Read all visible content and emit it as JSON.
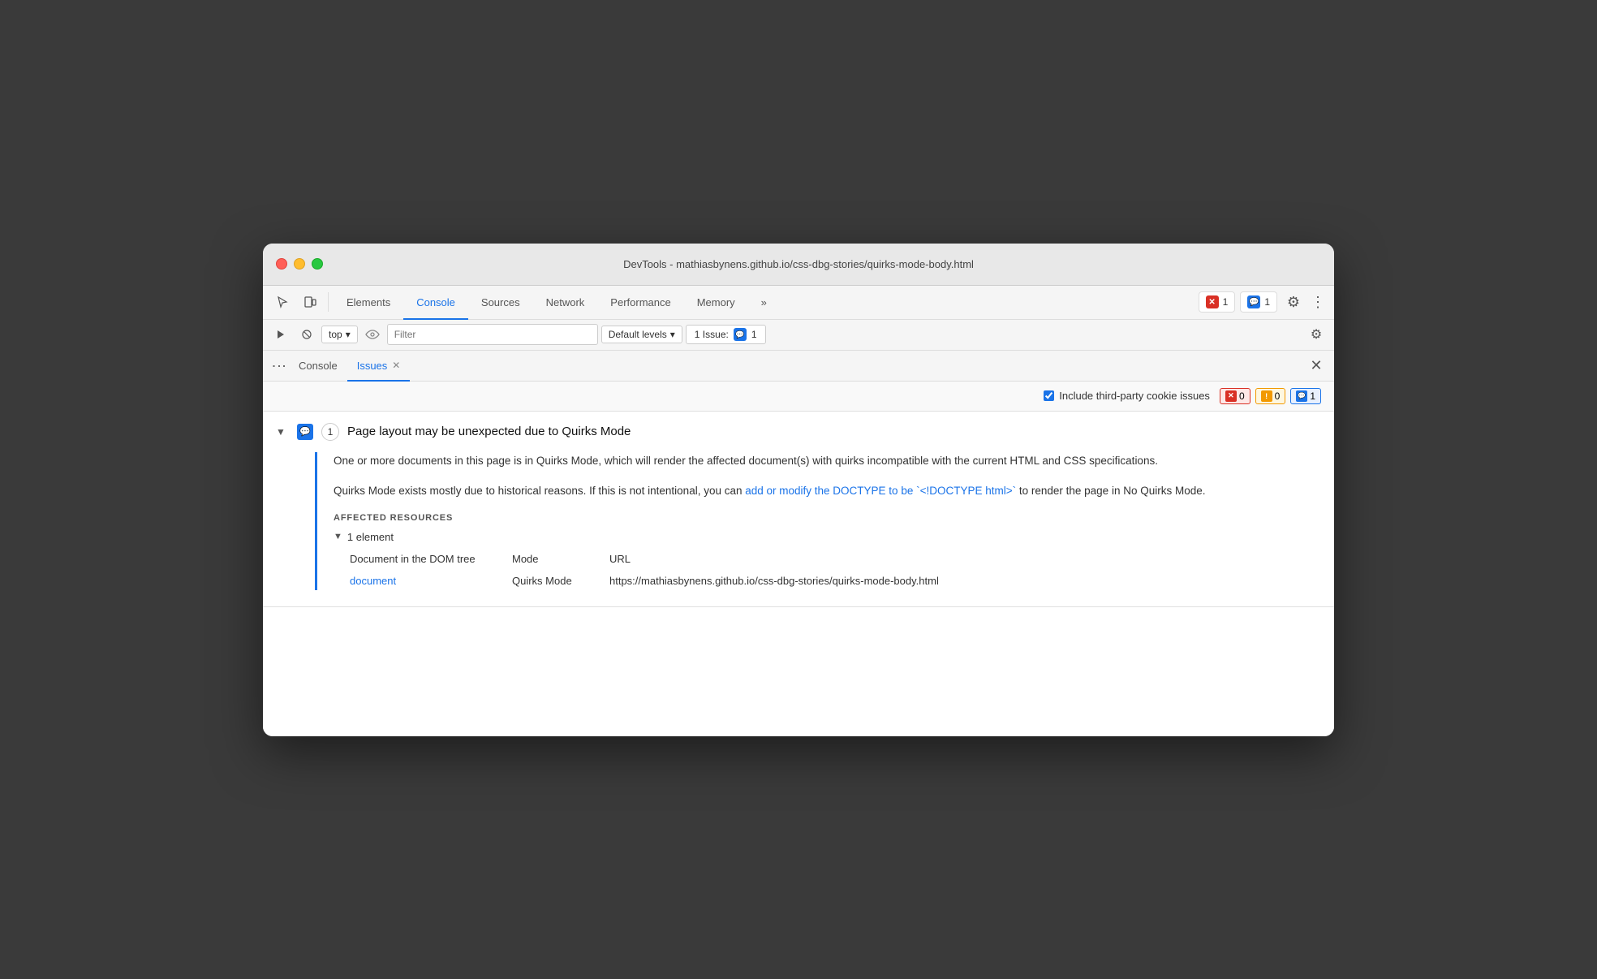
{
  "window": {
    "title": "DevTools - mathiasbynens.github.io/css-dbg-stories/quirks-mode-body.html"
  },
  "tabs": {
    "items": [
      {
        "label": "Elements",
        "active": false
      },
      {
        "label": "Console",
        "active": true
      },
      {
        "label": "Sources",
        "active": false
      },
      {
        "label": "Network",
        "active": false
      },
      {
        "label": "Performance",
        "active": false
      },
      {
        "label": "Memory",
        "active": false
      },
      {
        "label": "»",
        "active": false
      }
    ]
  },
  "toolbar": {
    "error_count": "1",
    "message_count": "1"
  },
  "console_toolbar": {
    "context_selector": "top",
    "filter_placeholder": "Filter",
    "levels_label": "Default levels",
    "issues_label": "1 Issue:",
    "issues_count": "1"
  },
  "panel": {
    "dots": "⋮",
    "tabs": [
      {
        "label": "Console",
        "active": false,
        "closeable": false
      },
      {
        "label": "Issues",
        "active": true,
        "closeable": true
      }
    ]
  },
  "issues_filter": {
    "include_third_party_label": "Include third-party cookie issues",
    "error_count": "0",
    "warning_count": "0",
    "info_count": "1"
  },
  "issue": {
    "title": "Page layout may be unexpected due to Quirks Mode",
    "count": "1",
    "description_1": "One or more documents in this page is in Quirks Mode, which will render the affected document(s) with quirks incompatible with the current HTML and CSS specifications.",
    "description_2_prefix": "Quirks Mode exists mostly due to historical reasons. If this is not intentional, you can ",
    "description_2_link": "add or modify the DOCTYPE to be `<!DOCTYPE html>`",
    "description_2_suffix": " to render the page in No Quirks Mode.",
    "affected_label": "Affected Resources",
    "element_count": "1 element",
    "col_doc": "Document in the DOM tree",
    "col_mode": "Mode",
    "col_url": "URL",
    "doc_link": "document",
    "mode_value": "Quirks Mode",
    "url_value": "https://mathiasbynens.github.io/css-dbg-stories/quirks-mode-body.html"
  }
}
